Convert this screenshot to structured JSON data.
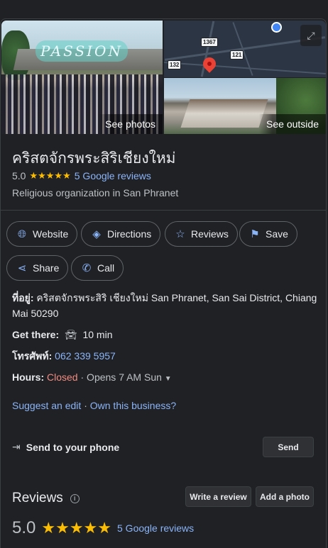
{
  "photos": {
    "main_label": "See photos",
    "main_logo_text": "PASSION",
    "outside_label": "See outside",
    "map_shields": [
      "1367",
      "121",
      "132"
    ]
  },
  "place": {
    "name": "คริสตจักรพระสิริเชียงใหม่",
    "rating": "5.0",
    "stars": "★★★★★",
    "reviews_link": "5 Google reviews",
    "category": "Religious organization in San Phranet"
  },
  "actions": {
    "website": "Website",
    "directions": "Directions",
    "reviews": "Reviews",
    "save": "Save",
    "share": "Share",
    "call": "Call"
  },
  "details": {
    "address_label": "ที่อยู่:",
    "address_value": "คริสตจักรพระสิริ เชียงใหม่ San Phranet, San Sai District, Chiang Mai 50290",
    "get_there_label": "Get there:",
    "get_there_value": "10 min",
    "phone_label": "โทรศัพท์:",
    "phone_value": "062 339 5957",
    "hours_label": "Hours:",
    "hours_status": "Closed",
    "hours_next": "· Opens 7 AM Sun",
    "suggest_edit": "Suggest an edit",
    "separator": "·",
    "own_business": "Own this business?"
  },
  "send": {
    "label": "Send to your phone",
    "button": "Send"
  },
  "reviews": {
    "heading": "Reviews",
    "write_review": "Write a review",
    "add_photo": "Add a photo",
    "rating": "5.0",
    "stars": "★★★★★",
    "count_link": "5 Google reviews"
  },
  "colors": {
    "background": "#202124",
    "link": "#8ab4f8",
    "star": "#fbbc04",
    "closed": "#f28b82"
  }
}
